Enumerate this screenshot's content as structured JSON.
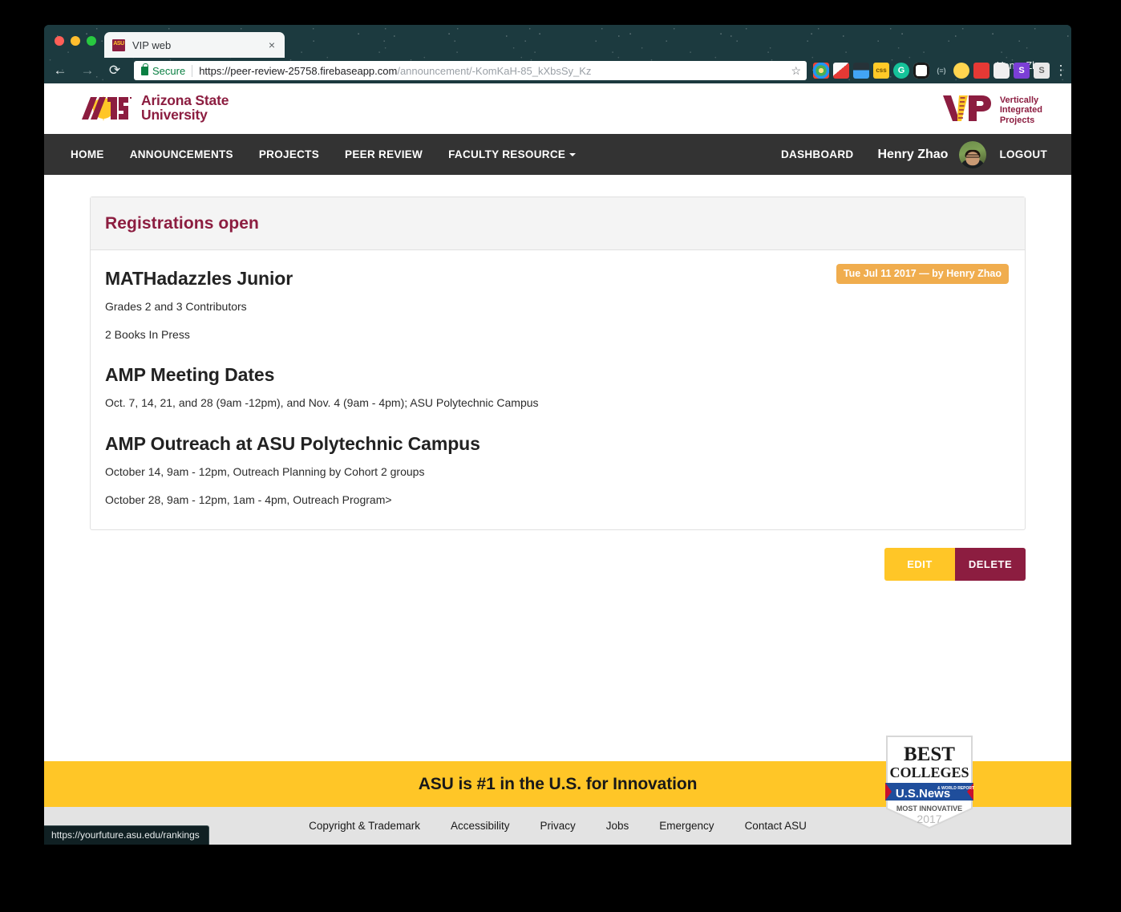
{
  "desktop": {
    "user_label": "Henry Zhao"
  },
  "browser": {
    "tab": {
      "title": "VIP web",
      "favicon": "asu-favicon",
      "close": "×"
    },
    "toolbar": {
      "back": "←",
      "forward": "→",
      "reload": "⟳",
      "secure_label": "Secure",
      "url_scheme": "https://peer-review-25758.firebaseapp.com",
      "url_path": "/announcement/-KomKaH-85_kXbsSy_Kz",
      "star": "☆",
      "menu": "⋮"
    },
    "extensions": [
      {
        "name": "chrome-extension-1",
        "glyph": "",
        "color": "#4db6ac"
      },
      {
        "name": "chrome-extension-2",
        "glyph": "",
        "color": "#e53935"
      },
      {
        "name": "chrome-extension-3",
        "glyph": "",
        "color": "#2f3b44"
      },
      {
        "name": "chrome-extension-css",
        "glyph": "css",
        "color": "#ffca28"
      },
      {
        "name": "grammarly-extension",
        "glyph": "G",
        "color": "#15c39a"
      },
      {
        "name": "chrome-extension-6",
        "glyph": "",
        "color": "#ffffff"
      },
      {
        "name": "chrome-extension-7",
        "glyph": "",
        "color": "#1c3a3f"
      },
      {
        "name": "chrome-extension-8",
        "glyph": "",
        "color": "#ffd54f"
      },
      {
        "name": "chrome-extension-9",
        "glyph": "",
        "color": "#e53935"
      },
      {
        "name": "chrome-extension-10",
        "glyph": "",
        "color": "#f5f5f5"
      },
      {
        "name": "chrome-extension-s-purple",
        "glyph": "S",
        "color": "#7b3fd6"
      },
      {
        "name": "chrome-extension-s-grey",
        "glyph": "S",
        "color": "#e8e8e8"
      }
    ],
    "status_bubble": "https://yourfuture.asu.edu/rankings"
  },
  "brand": {
    "asu_line1": "Arizona State",
    "asu_line2": "University",
    "asu_mark_text": "ASU",
    "vip_mark_text": "VIP",
    "vip_line1": "Vertically",
    "vip_line2": "Integrated",
    "vip_line3": "Projects",
    "maroon": "#8c1d40",
    "gold": "#ffc627"
  },
  "nav": {
    "items": [
      {
        "name": "home",
        "label": "HOME",
        "has_caret": false
      },
      {
        "name": "announcements",
        "label": "ANNOUNCEMENTS",
        "has_caret": false
      },
      {
        "name": "projects",
        "label": "PROJECTS",
        "has_caret": false
      },
      {
        "name": "peer-review",
        "label": "PEER REVIEW",
        "has_caret": false
      },
      {
        "name": "faculty-resource",
        "label": "FACULTY RESOURCE",
        "has_caret": true
      }
    ],
    "dashboard_label": "DASHBOARD",
    "user_name": "Henry Zhao",
    "logout_label": "LOGOUT"
  },
  "announcement": {
    "panel_title": "Registrations open",
    "date_badge": "Tue Jul 11 2017 — by Henry Zhao",
    "blocks": [
      {
        "type": "heading",
        "text": "MATHadazzles Junior"
      },
      {
        "type": "paragraph",
        "text": "Grades 2 and 3 Contributors"
      },
      {
        "type": "paragraph",
        "text": "2 Books In Press"
      },
      {
        "type": "heading",
        "text": "AMP Meeting Dates"
      },
      {
        "type": "paragraph",
        "text": "Oct. 7, 14, 21, and 28 (9am -12pm), and Nov. 4 (9am - 4pm); ASU Polytechnic Campus"
      },
      {
        "type": "heading",
        "text": "AMP Outreach at ASU Polytechnic Campus"
      },
      {
        "type": "paragraph",
        "text": "October 14, 9am - 12pm, Outreach Planning by Cohort 2 groups"
      },
      {
        "type": "paragraph",
        "text": "October 28, 9am - 12pm, 1am - 4pm, Outreach Program>"
      }
    ],
    "edit_label": "EDIT",
    "delete_label": "DELETE"
  },
  "footer": {
    "innovation_text": "ASU is #1 in the U.S. for Innovation",
    "badge": {
      "line1": "BEST",
      "line2": "COLLEGES",
      "brand": "U.S.News",
      "brand_sub": "& WORLD REPORT",
      "line3": "MOST INNOVATIVE",
      "year": "2017"
    },
    "links": [
      {
        "name": "copyright-trademark",
        "label": "Copyright & Trademark"
      },
      {
        "name": "accessibility",
        "label": "Accessibility"
      },
      {
        "name": "privacy",
        "label": "Privacy"
      },
      {
        "name": "jobs",
        "label": "Jobs"
      },
      {
        "name": "emergency",
        "label": "Emergency"
      },
      {
        "name": "contact-asu",
        "label": "Contact ASU"
      }
    ]
  }
}
